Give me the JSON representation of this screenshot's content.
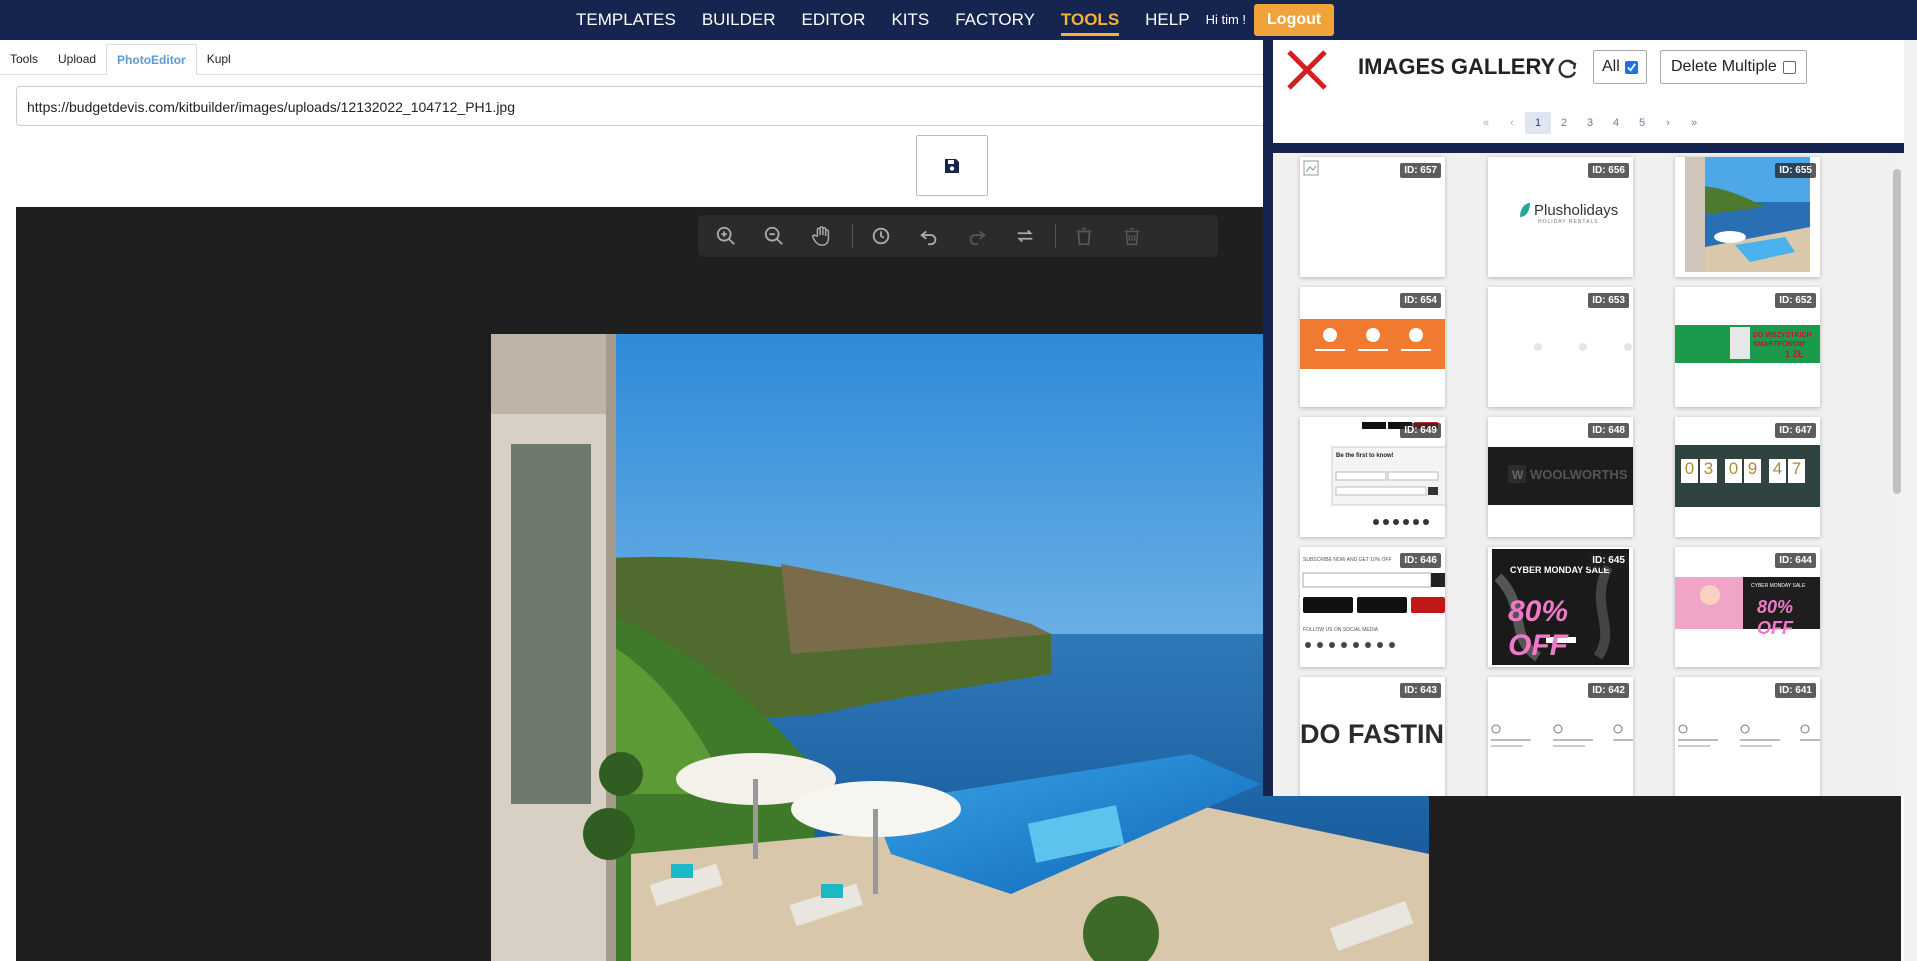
{
  "nav": {
    "items": [
      "TEMPLATES",
      "BUILDER",
      "EDITOR",
      "KITS",
      "FACTORY",
      "TOOLS",
      "HELP"
    ],
    "active": "TOOLS",
    "greeting": "Hi tim !",
    "logout_label": "Logout",
    "colors": {
      "bar": "#15254f",
      "accent": "#f5b335",
      "logout": "#f0a33a"
    }
  },
  "tabs": [
    "Tools",
    "Upload",
    "PhotoEditor",
    "Kupl"
  ],
  "active_tab": "PhotoEditor",
  "url_value": "https://budgetdevis.com/kitbuilder/images/uploads/12132022_104712_PH1.jpg",
  "toolbar": {
    "tools": [
      "zoom-in-icon",
      "zoom-out-icon",
      "hand-icon",
      "history-icon",
      "undo-icon",
      "redo-icon",
      "reset-icon",
      "delete-icon",
      "delete-all-icon"
    ]
  },
  "gallery": {
    "title": "IMAGES GALLERY",
    "all_label": "All",
    "all_checked": true,
    "delete_multiple_label": "Delete Multiple",
    "delete_multiple_checked": false,
    "pager": {
      "first": "«",
      "prev": "‹",
      "pages": [
        "1",
        "2",
        "3",
        "4",
        "5"
      ],
      "current": "1",
      "next": "›",
      "last": "»"
    },
    "items": [
      {
        "id": "ID: 657",
        "kind": "blank"
      },
      {
        "id": "ID: 656",
        "kind": "logo",
        "text": "Plusholidays",
        "sub": "HOLIDAY RENTALS"
      },
      {
        "id": "ID: 655",
        "kind": "photo"
      },
      {
        "id": "ID: 654",
        "kind": "orange-banner"
      },
      {
        "id": "ID: 653",
        "kind": "faint"
      },
      {
        "id": "ID: 652",
        "kind": "green-banner",
        "text": "DO WSZYSTKICH SMARTFONÓW",
        "sub": "1 ZŁ"
      },
      {
        "id": "ID: 649",
        "kind": "form",
        "text": "Be the first to know!"
      },
      {
        "id": "ID: 648",
        "kind": "dark-logo",
        "text": "WOOLWORTHS"
      },
      {
        "id": "ID: 647",
        "kind": "countdown",
        "digits": [
          "0",
          "3",
          "0",
          "9",
          "4",
          "7"
        ]
      },
      {
        "id": "ID: 646",
        "kind": "subscribe",
        "text": "SUBSCRIBE NOW AND GET 10% OFF",
        "sub": "FOLLOW US ON SOCIAL MEDIA"
      },
      {
        "id": "ID: 645",
        "kind": "sale-dark",
        "text": "CYBER MONDAY SALE",
        "sub": "80% OFF"
      },
      {
        "id": "ID: 644",
        "kind": "sale-pink",
        "text": "CYBER MONDAY SALE",
        "sub": "80% OFF"
      },
      {
        "id": "ID: 643",
        "kind": "fasting",
        "text": "DO FASTING"
      },
      {
        "id": "ID: 642",
        "kind": "icons-row"
      },
      {
        "id": "ID: 641",
        "kind": "icons-row"
      }
    ]
  }
}
